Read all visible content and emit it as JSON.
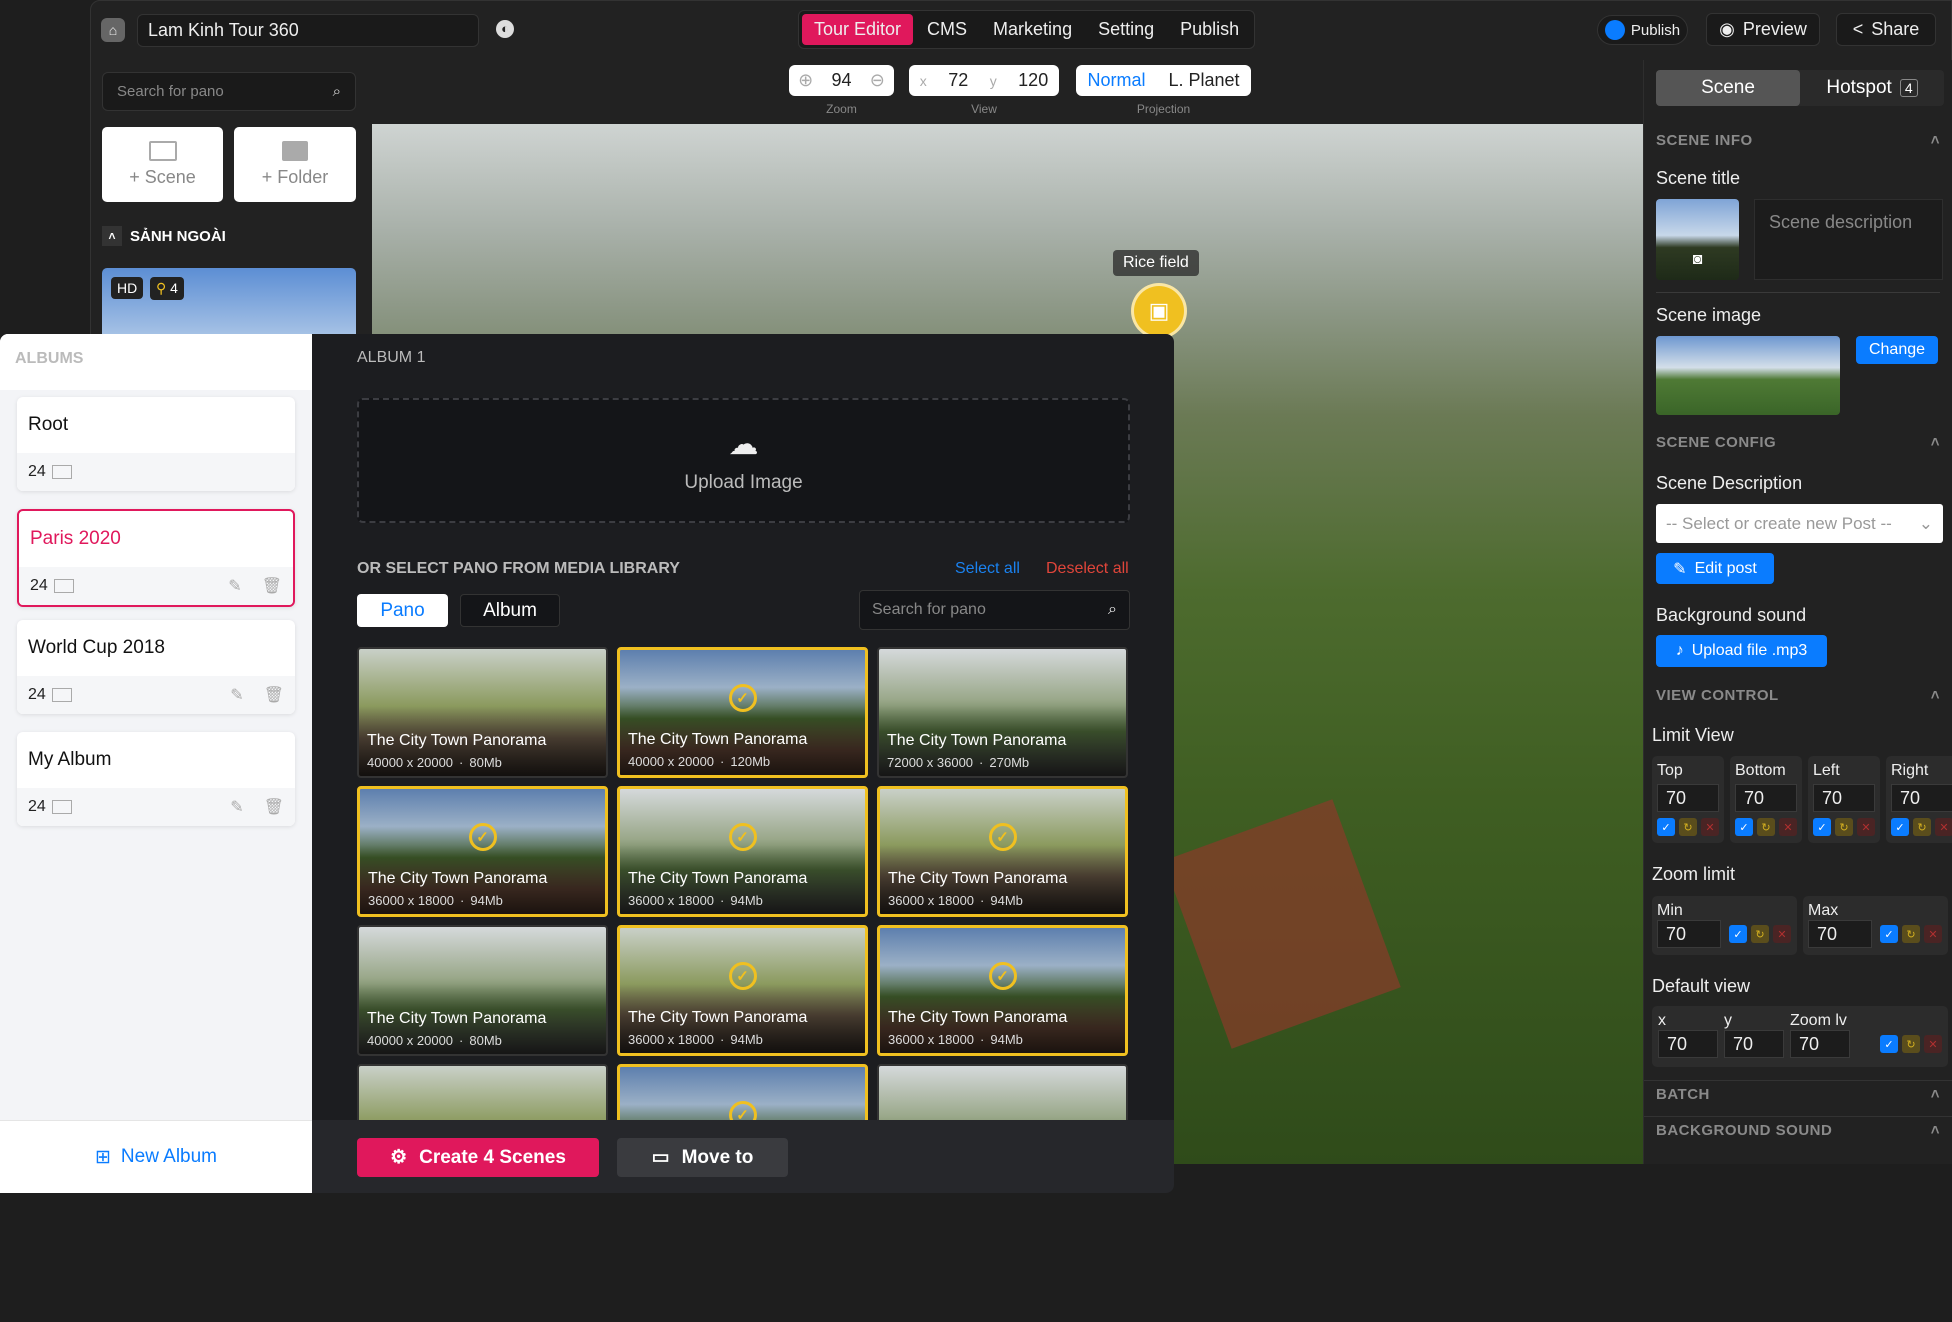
{
  "topbar": {
    "title": "Lam Kinh Tour 360",
    "nav": [
      "Tour Editor",
      "CMS",
      "Marketing",
      "Setting",
      "Publish"
    ],
    "active_nav": "Tour Editor",
    "publish_toggle": "Publish",
    "preview": "Preview",
    "share": "Share"
  },
  "controls": {
    "zoom_value": "94",
    "zoom_label": "Zoom",
    "view_x_label": "x",
    "view_x": "72",
    "view_y_label": "y",
    "view_y": "120",
    "view_label": "View",
    "projection": [
      "Normal",
      "L. Planet"
    ],
    "projection_active": "Normal",
    "projection_label": "Projection"
  },
  "left": {
    "search_placeholder": "Search for pano",
    "add_scene": "+ Scene",
    "add_folder": "+ Folder",
    "folder": "SẢNH NGOÀI",
    "scene_badge_hd": "HD",
    "scene_badge_hotspots": "4"
  },
  "hotspot": {
    "label": "Rice field"
  },
  "right": {
    "tabs": {
      "scene": "Scene",
      "hotspot": "Hotspot",
      "hotspot_count": "4"
    },
    "scene_info": "SCENE INFO",
    "scene_title": "Scene title",
    "desc_placeholder": "Scene description",
    "scene_image": "Scene image",
    "change": "Change",
    "scene_config": "SCENE CONFIG",
    "scene_description": "Scene Description",
    "post_placeholder": "-- Select or create new Post --",
    "edit_post": "Edit post",
    "bg_sound": "Background sound",
    "upload_mp3": "Upload file .mp3",
    "view_control": "VIEW CONTROL",
    "limit_view": "Limit View",
    "limits": [
      {
        "label": "Top",
        "value": "70"
      },
      {
        "label": "Bottom",
        "value": "70"
      },
      {
        "label": "Left",
        "value": "70"
      },
      {
        "label": "Right",
        "value": "70"
      }
    ],
    "zoom_limit": "Zoom limit",
    "zoom_limits": [
      {
        "label": "Min",
        "value": "70"
      },
      {
        "label": "Max",
        "value": "70"
      }
    ],
    "default_view": "Default view",
    "defaults": [
      {
        "label": "x",
        "value": "70"
      },
      {
        "label": "y",
        "value": "70"
      },
      {
        "label": "Zoom lv",
        "value": "70"
      }
    ],
    "batch": "BATCH",
    "background_sound": "BACKGROUND SOUND"
  },
  "albums": {
    "header": "ALBUMS",
    "items": [
      {
        "name": "Root",
        "count": "24"
      },
      {
        "name": "Paris 2020",
        "count": "24",
        "active": true
      },
      {
        "name": "World Cup 2018",
        "count": "24"
      },
      {
        "name": "My Album",
        "count": "24"
      }
    ],
    "new_album": "New Album",
    "accent": "#e0185c"
  },
  "album_panel": {
    "title": "ALBUM 1",
    "upload": "Upload Image",
    "library_title": "OR SELECT PANO FROM MEDIA LIBRARY",
    "select_all": "Select all",
    "deselect_all": "Deselect all",
    "tabs": [
      "Pano",
      "Album"
    ],
    "search_placeholder": "Search for pano",
    "panos": [
      {
        "title": "The City Town Panorama",
        "dims": "40000 x 20000",
        "size": "80Mb",
        "selected": false
      },
      {
        "title": "The City Town Panorama",
        "dims": "40000 x 20000",
        "size": "120Mb",
        "selected": true
      },
      {
        "title": "The City Town Panorama",
        "dims": "72000 x 36000",
        "size": "270Mb",
        "selected": false
      },
      {
        "title": "The City Town Panorama",
        "dims": "36000 x 18000",
        "size": "94Mb",
        "selected": true
      },
      {
        "title": "The City Town Panorama",
        "dims": "36000 x 18000",
        "size": "94Mb",
        "selected": true
      },
      {
        "title": "The City Town Panorama",
        "dims": "36000 x 18000",
        "size": "94Mb",
        "selected": true
      },
      {
        "title": "The City Town Panorama",
        "dims": "40000 x 20000",
        "size": "80Mb",
        "selected": false
      },
      {
        "title": "The City Town Panorama",
        "dims": "36000 x 18000",
        "size": "94Mb",
        "selected": true
      },
      {
        "title": "The City Town Panorama",
        "dims": "36000 x 18000",
        "size": "94Mb",
        "selected": true
      },
      {
        "title": "",
        "dims": "",
        "size": "",
        "selected": false
      },
      {
        "title": "",
        "dims": "",
        "size": "",
        "selected": true
      },
      {
        "title": "",
        "dims": "",
        "size": "",
        "selected": false
      }
    ],
    "create": "Create 4 Scenes",
    "move_to": "Move to"
  }
}
